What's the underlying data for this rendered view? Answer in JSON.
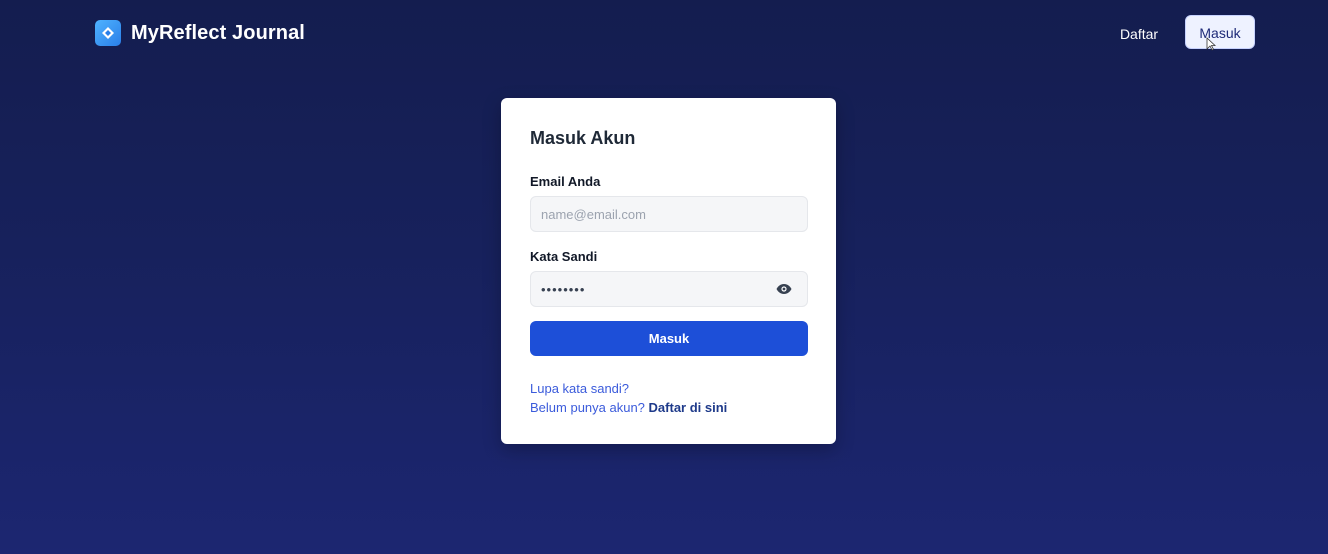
{
  "navbar": {
    "brand_name": "MyReflect Journal",
    "brand_icon": "diamond-logo-icon",
    "daftar_label": "Daftar",
    "masuk_label": "Masuk"
  },
  "login_card": {
    "title": "Masuk Akun",
    "email_label": "Email Anda",
    "email_placeholder": "name@email.com",
    "email_value": "",
    "password_label": "Kata Sandi",
    "password_value": "passwor1",
    "password_toggle_icon": "eye-icon",
    "submit_label": "Masuk",
    "forgot_label": "Lupa kata sandi?",
    "register_prompt": "Belum punya akun?",
    "register_link": "Daftar di sini"
  },
  "colors": {
    "background_top": "#141d4f",
    "background_bottom": "#1c2671",
    "primary_button": "#1d4fd8",
    "link": "#3b5bdb",
    "brand_logo": "#2a7fe8"
  }
}
